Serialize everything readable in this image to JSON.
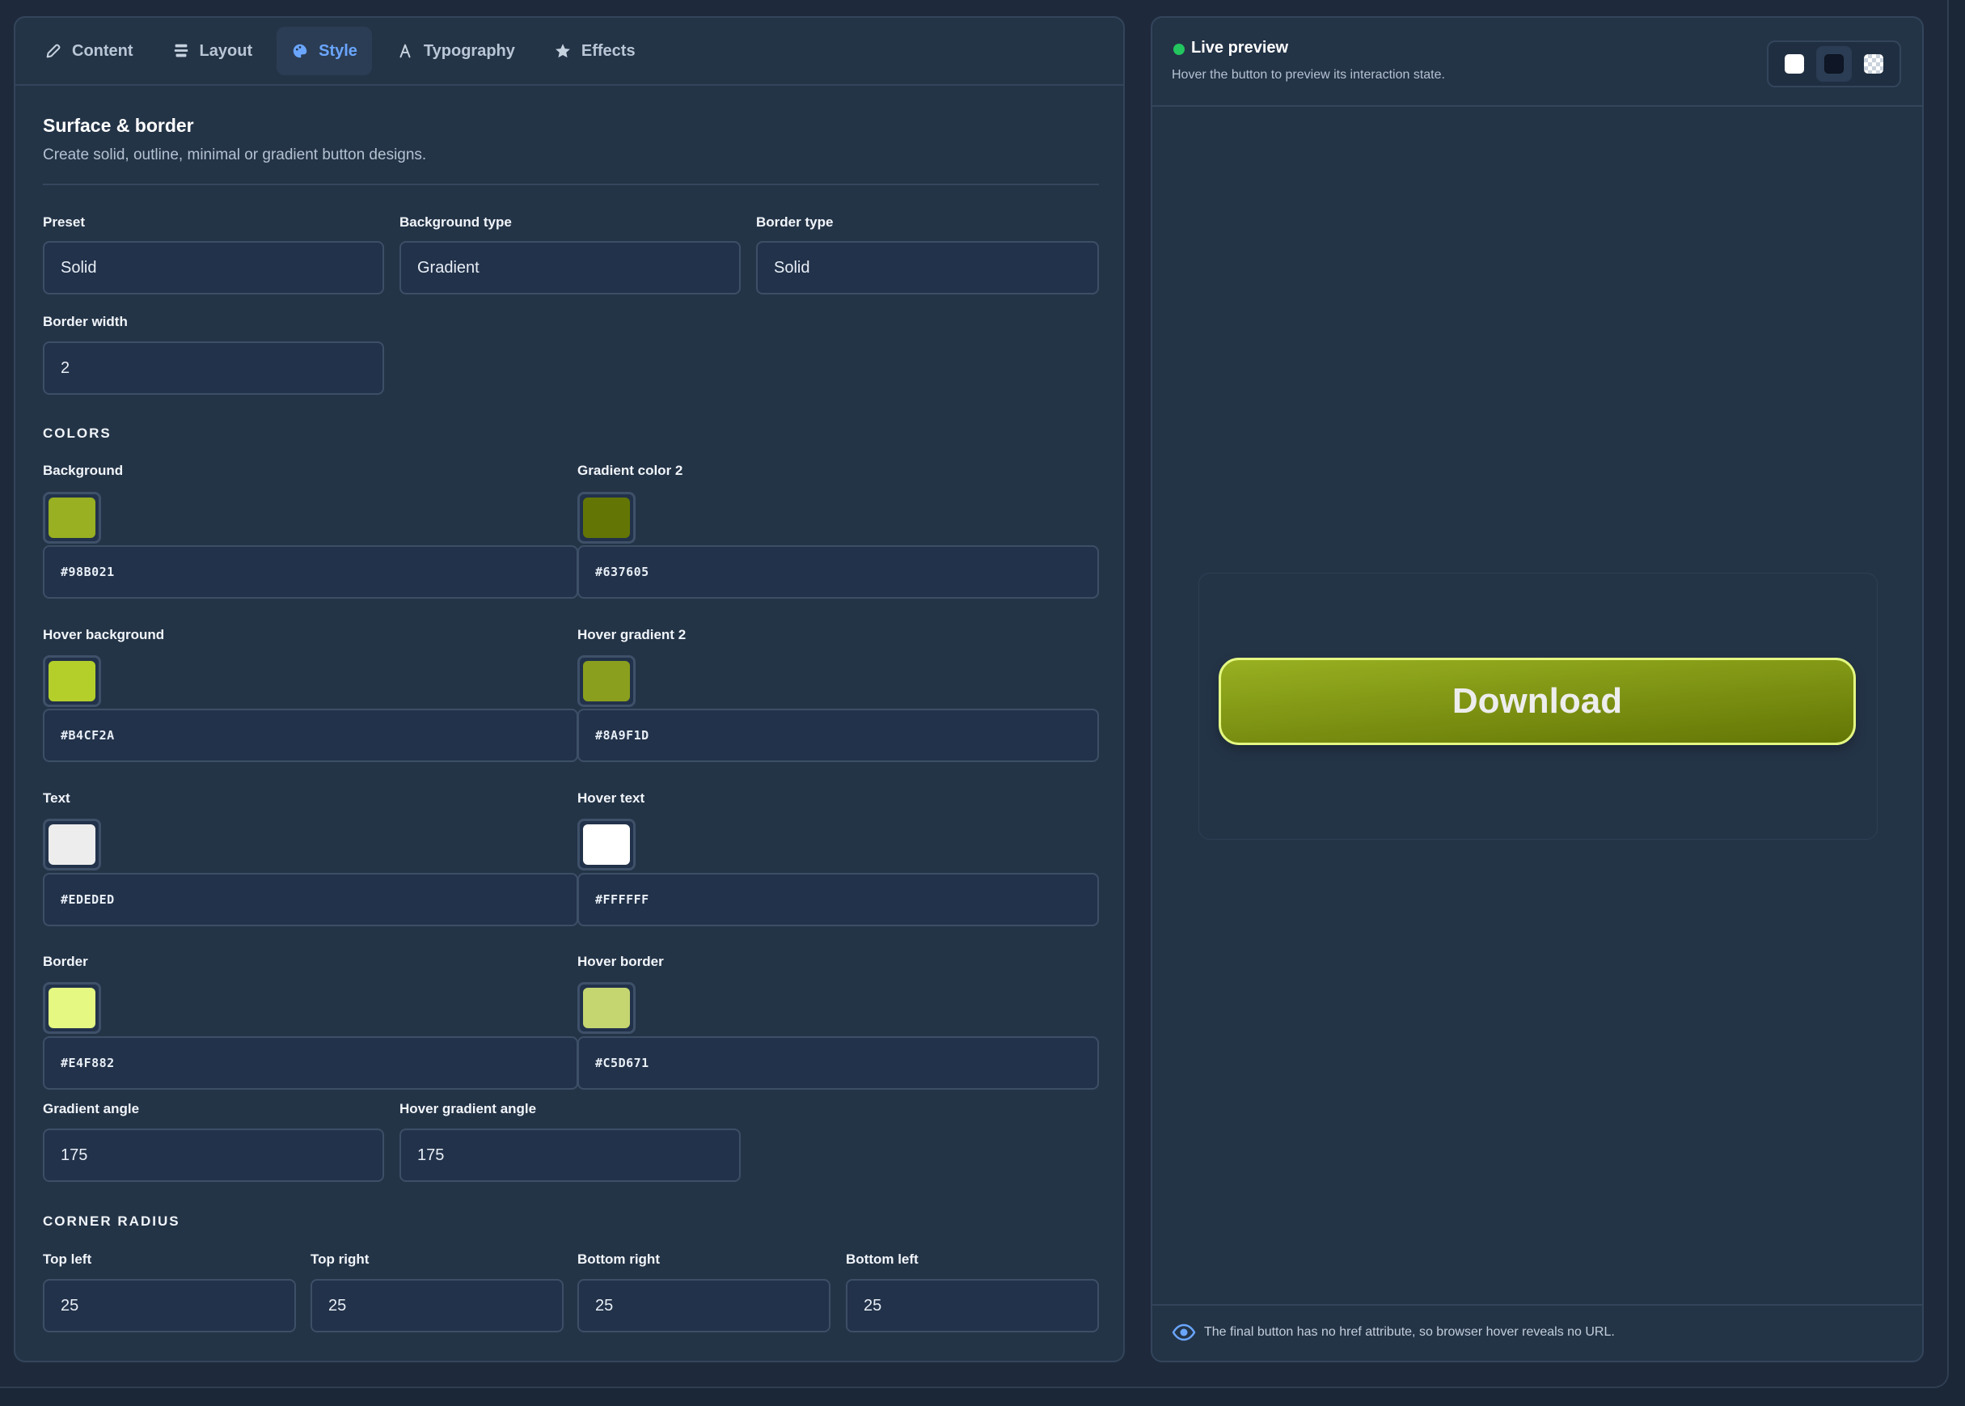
{
  "tabs": [
    {
      "label": "Content",
      "icon": "pencil-icon"
    },
    {
      "label": "Layout",
      "icon": "layout-icon"
    },
    {
      "label": "Style",
      "icon": "palette-icon",
      "active": true
    },
    {
      "label": "Typography",
      "icon": "text-icon"
    },
    {
      "label": "Effects",
      "icon": "star-icon"
    }
  ],
  "section": {
    "title": "Surface & border",
    "subtitle": "Create solid, outline, minimal or gradient button designs."
  },
  "fields": {
    "preset": {
      "label": "Preset",
      "value": "Solid"
    },
    "background_type": {
      "label": "Background type",
      "value": "Gradient"
    },
    "border_type": {
      "label": "Border type",
      "value": "Solid"
    },
    "border_width": {
      "label": "Border width",
      "value": "2"
    }
  },
  "colors": {
    "title": "COLORS",
    "background": {
      "label": "Background",
      "value": "#98B021"
    },
    "gradient_color_2": {
      "label": "Gradient color 2",
      "value": "#637605"
    },
    "hover_background": {
      "label": "Hover background",
      "value": "#B4CF2A"
    },
    "hover_gradient_2": {
      "label": "Hover gradient 2",
      "value": "#8A9F1D"
    },
    "text": {
      "label": "Text",
      "value": "#EDEDED"
    },
    "hover_text": {
      "label": "Hover text",
      "value": "#FFFFFF"
    },
    "border": {
      "label": "Border",
      "value": "#E4F882"
    },
    "hover_border": {
      "label": "Hover border",
      "value": "#C5D671"
    }
  },
  "angles": {
    "gradient_angle": {
      "label": "Gradient angle",
      "value": "175"
    },
    "hover_gradient_angle": {
      "label": "Hover gradient angle",
      "value": "175"
    }
  },
  "corner_radius": {
    "title": "CORNER RADIUS",
    "top_left": {
      "label": "Top left",
      "value": "25"
    },
    "top_right": {
      "label": "Top right",
      "value": "25"
    },
    "bottom_right": {
      "label": "Bottom right",
      "value": "25"
    },
    "bottom_left": {
      "label": "Bottom left",
      "value": "25"
    }
  },
  "preview": {
    "title": "Live preview",
    "subtitle": "Hover the button to preview its interaction state.",
    "button_label": "Download",
    "backgrounds": [
      "white",
      "dark",
      "transparent"
    ],
    "active_background": "dark",
    "footer_note": "The final button has no href attribute, so browser hover reveals no URL.",
    "status_color": "#22C55E"
  },
  "accent_color": "#6AA6FF"
}
